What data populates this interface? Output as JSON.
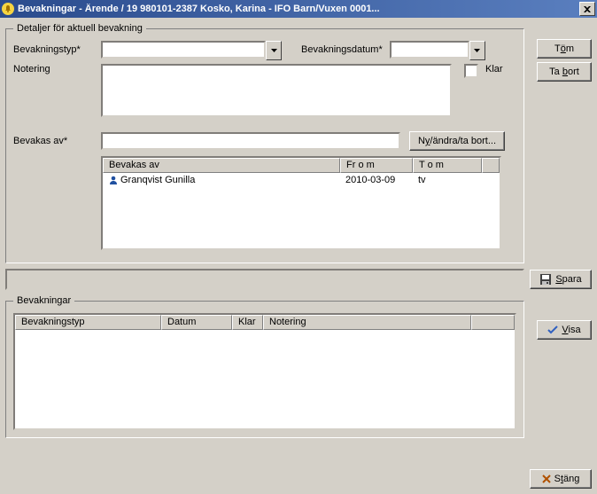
{
  "title": "Bevakningar - Ärende /  19 980101-2387  Kosko, Karina  -   IFO Barn/Vuxen  0001...",
  "group_detail": "Detaljer för aktuell bevakning",
  "labels": {
    "bevakningstyp": "Bevakningstyp*",
    "bevakningsdatum": "Bevakningsdatum*",
    "notering": "Notering",
    "klar": "Klar",
    "bevakas_av": "Bevakas av*"
  },
  "buttons": {
    "tom": "Töm",
    "ta_bort": "Ta bort",
    "ny_andra": "Ny/ändra/ta bort...",
    "spara": "Spara",
    "visa": "Visa",
    "stang": "Stäng"
  },
  "inputs": {
    "bevakningstyp": "",
    "bevakningsdatum": "",
    "notering": "",
    "bevakas_av": ""
  },
  "bevakas_cols": {
    "c1": " Bevakas av",
    "c2": " Fr o m",
    "c3": " T o m"
  },
  "bevakas_rows": [
    {
      "name": "Granqvist Gunilla",
      "from": "2010-03-09",
      "to": "tv"
    }
  ],
  "group_list": "Bevakningar",
  "list_cols": {
    "c1": " Bevakningstyp",
    "c2": " Datum",
    "c3": " Klar",
    "c4": " Notering"
  }
}
